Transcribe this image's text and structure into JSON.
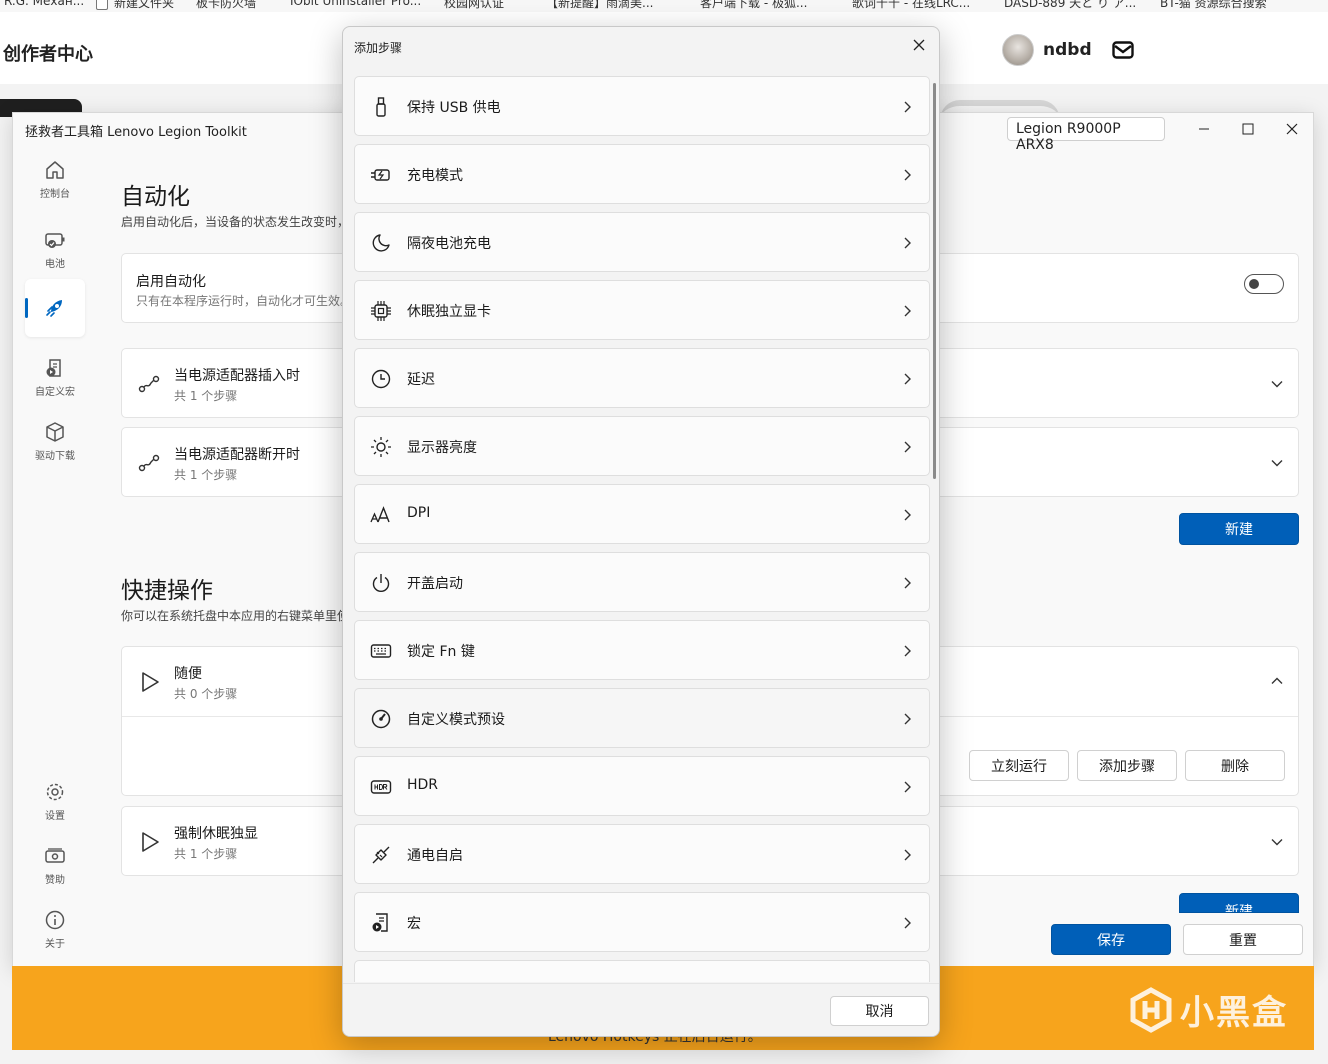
{
  "bookmarks": [
    "R.G. Механ...",
    "新建文件夹",
    "板卡防火墙",
    "IObit Uninstaller Pro...",
    "校园网认证",
    "【新提醒】雨滴美...",
    "客户端下载 - 极狐...",
    "歌词千千 - 在线LRC...",
    "DASD-889 天と り ア...",
    "BT-猫 资源综合搜索"
  ],
  "web": {
    "title": "创作者中心",
    "username": "ndbd"
  },
  "app": {
    "title": "拯救者工具箱 Lenovo Legion Toolkit",
    "model": "Legion R9000P ARX8",
    "nav": [
      {
        "label": "控制台"
      },
      {
        "label": "电池"
      },
      {
        "label": ""
      },
      {
        "label": "自定义宏"
      },
      {
        "label": "驱动下载"
      },
      {
        "label": "设置"
      },
      {
        "label": "赞助"
      },
      {
        "label": "关于"
      }
    ],
    "automation": {
      "title": "自动化",
      "desc": "启用自动化后，当设备的状态发生改变时，",
      "enable_title": "启用自动化",
      "enable_desc": "只有在本程序运行时，自动化才可生效。",
      "enabled": false,
      "rules": [
        {
          "title": "当电源适配器插入时",
          "steps": "共 1 个步骤"
        },
        {
          "title": "当电源适配器断开时",
          "steps": "共 1 个步骤"
        }
      ],
      "new_label": "新建"
    },
    "quick": {
      "title": "快捷操作",
      "desc": "你可以在系统托盘中本应用的右键菜单里使",
      "items": [
        {
          "title": "随便",
          "steps": "共 0 个步骤"
        },
        {
          "title": "强制休眠独显",
          "steps": "共 1 个步骤"
        }
      ],
      "run_now": "立刻运行",
      "add_step": "添加步骤",
      "delete": "删除",
      "new_label": "新建"
    },
    "save_label": "保存",
    "reset_label": "重置",
    "hotkeys_notice": "Lenovo Hotkeys 正在后台运行。"
  },
  "watermark": "小黑盒",
  "dialog": {
    "title": "添加步骤",
    "steps": [
      {
        "label": "保持 USB 供电",
        "icon": "usb-icon"
      },
      {
        "label": "充电模式",
        "icon": "battery-charge-icon"
      },
      {
        "label": "隔夜电池充电",
        "icon": "moon-icon"
      },
      {
        "label": "休眠独立显卡",
        "icon": "chip-icon"
      },
      {
        "label": "延迟",
        "icon": "clock-icon"
      },
      {
        "label": "显示器亮度",
        "icon": "brightness-icon"
      },
      {
        "label": "DPI",
        "icon": "text-size-icon"
      },
      {
        "label": "开盖启动",
        "icon": "power-icon"
      },
      {
        "label": "锁定 Fn 键",
        "icon": "keyboard-icon"
      },
      {
        "label": "自定义模式预设",
        "icon": "gauge-icon"
      },
      {
        "label": "HDR",
        "icon": "hdr-icon"
      },
      {
        "label": "通电自启",
        "icon": "plug-icon"
      },
      {
        "label": "宏",
        "icon": "macro-icon"
      }
    ],
    "cancel_label": "取消"
  }
}
